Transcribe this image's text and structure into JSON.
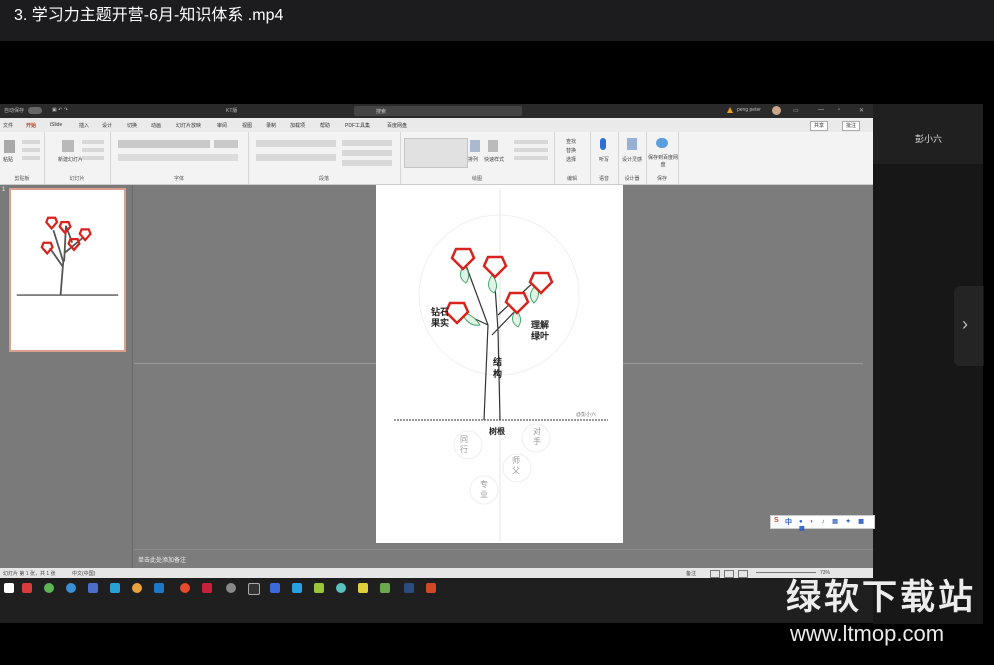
{
  "video_title": "3. 学习力主题开营-6月-知识体系 .mp4",
  "participant_name": "彭小六",
  "ppt": {
    "autosave_label": "自动保存",
    "doc_title": "KT版",
    "search_placeholder": "搜索",
    "user_name": "peng peter",
    "tabs": [
      "文件",
      "开始",
      "iSlide",
      "插入",
      "设计",
      "切换",
      "动画",
      "幻灯片放映",
      "审阅",
      "视图",
      "录制",
      "加载项",
      "帮助",
      "PDF工具集",
      "百度网盘"
    ],
    "share_btn": "共享",
    "comment_btn": "批注",
    "ribbon_groups": {
      "clipboard": "剪贴板",
      "slides": "幻灯片",
      "font": "字体",
      "paragraph": "段落",
      "drawing": "绘图",
      "editing": "编辑",
      "voice": "语音",
      "designer": "设计器",
      "save": "保存"
    },
    "ribbon_items": {
      "paste": "粘贴",
      "new_slide": "新建幻灯片",
      "arrange": "排列",
      "quick_styles": "快速样式",
      "find": "查找",
      "replace": "替换",
      "select": "选择",
      "dictate": "听写",
      "design_ideas": "设计灵感",
      "save_baidu": "保存到百度网盘"
    },
    "slide_number": "1",
    "notes_placeholder": "单击此处添加备注",
    "status_left": "幻灯片 第 1 张，共 1 张",
    "status_lang": "中文(中国)",
    "status_notes": "备注",
    "zoom": "73%"
  },
  "slide": {
    "label_diamond": "钻石果实",
    "label_leaf": "理解绿叶",
    "label_trunk": "结构",
    "label_root": "树根",
    "label_peer": "同行",
    "label_rival": "对手",
    "label_mentor": "师父",
    "label_expert": "专业",
    "signature": "@彭小六"
  },
  "ime": {
    "logo": "S",
    "mode": "中"
  },
  "watermark": {
    "brand": "绿软下载站",
    "url": "www.ltmop.com"
  },
  "colors": {
    "accent_red": "#d9221c",
    "leaf_green": "#4aa96c",
    "ppt_accent": "#b7472a"
  }
}
